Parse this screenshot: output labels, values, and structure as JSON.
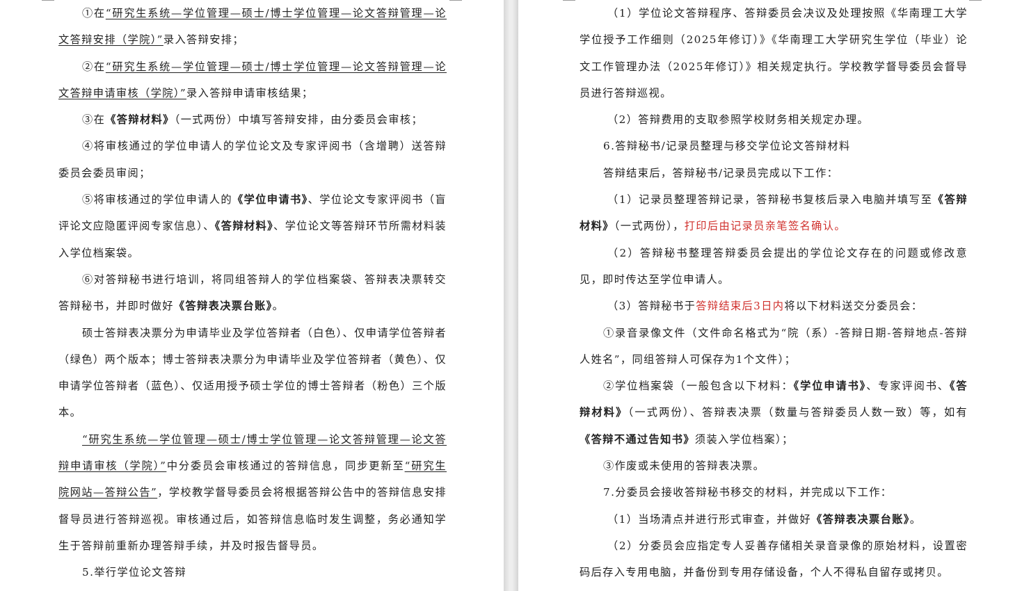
{
  "left_page": {
    "paragraphs": [
      {
        "segments": [
          {
            "t": "①在",
            "s": ""
          },
          {
            "t": "“研究生系统—学位管理—硕士/博士学位管理—论文答辩管理—论文答辩安排（学院）”",
            "s": "u"
          },
          {
            "t": "录入答辩安排；",
            "s": ""
          }
        ]
      },
      {
        "segments": [
          {
            "t": "②在",
            "s": ""
          },
          {
            "t": "“研究生系统—学位管理—硕士/博士学位管理—论文答辩管理—论文答辩申请审核（学院）”",
            "s": "u"
          },
          {
            "t": "录入答辩申请审核结果；",
            "s": ""
          }
        ]
      },
      {
        "segments": [
          {
            "t": "③在",
            "s": ""
          },
          {
            "t": "《答辩材料》",
            "s": "b"
          },
          {
            "t": "（一式两份）中填写答辩安排，由分委员会审核；",
            "s": ""
          }
        ]
      },
      {
        "segments": [
          {
            "t": "④将审核通过的学位申请人的学位论文及专家评阅书（含增聘）送答辩委员会委员审阅；",
            "s": ""
          }
        ]
      },
      {
        "segments": [
          {
            "t": "⑤将审核通过的学位申请人的",
            "s": ""
          },
          {
            "t": "《学位申请书》",
            "s": "b"
          },
          {
            "t": "、学位论文专家评阅书（盲评论文应隐匿评阅专家信息）、",
            "s": ""
          },
          {
            "t": "《答辩材料》",
            "s": "b"
          },
          {
            "t": "、学位论文等答辩环节所需材料装入学位档案袋。",
            "s": ""
          }
        ]
      },
      {
        "segments": [
          {
            "t": "⑥对答辩秘书进行培训，将同组答辩人的学位档案袋、答辩表决票转交答辩秘书，并即时做好",
            "s": ""
          },
          {
            "t": "《答辩表决票台账》",
            "s": "b"
          },
          {
            "t": "。",
            "s": ""
          }
        ]
      },
      {
        "segments": [
          {
            "t": "硕士答辩表决票分为申请毕业及学位答辩者（白色）、仅申请学位答辩者（绿色）两个版本；博士答辩表决票分为申请毕业及学位答辩者（黄色）、仅申请学位答辩者（蓝色）、仅适用授予硕士学位的博士答辩者（粉色）三个版本。",
            "s": ""
          }
        ]
      },
      {
        "segments": [
          {
            "t": "“研究生系统—学位管理—硕士/博士学位管理—论文答辩管理—论文答辩申请审核（学院）”",
            "s": "u"
          },
          {
            "t": "中分委员会审核通过的答辩信息，同步更新至",
            "s": ""
          },
          {
            "t": "“研究生院网站—答辩公告”",
            "s": "u"
          },
          {
            "t": "，学校教学督导委员会将根据答辩公告中的答辩信息安排督导员进行答辩巡视。审核通过后，如答辩信息临时发生调整，务必通知学生于答辩前重新办理答辩手续，并及时报告督导员。",
            "s": ""
          }
        ]
      },
      {
        "segments": [
          {
            "t": "5.举行学位论文答辩",
            "s": ""
          }
        ]
      }
    ]
  },
  "right_page": {
    "paragraphs": [
      {
        "segments": [
          {
            "t": "（1）学位论文答辩程序、答辩委员会决议及处理按照《华南理工大学学位授予工作细则（2025年修订）》《华南理工大学研究生学位（毕业）论文工作管理办法（2025年修订）》相关规定执行。学校教学督导委员会督导员进行答辩巡视。",
            "s": ""
          }
        ]
      },
      {
        "segments": [
          {
            "t": "（2）答辩费用的支取参照学校财务相关规定办理。",
            "s": ""
          }
        ]
      },
      {
        "segments": [
          {
            "t": "6.答辩秘书/记录员整理与移交学位论文答辩材料",
            "s": ""
          }
        ]
      },
      {
        "segments": [
          {
            "t": "答辩结束后，答辩秘书/记录员完成以下工作：",
            "s": ""
          }
        ]
      },
      {
        "segments": [
          {
            "t": "（1）记录员整理答辩记录，答辩秘书复核后录入电脑并填写至",
            "s": ""
          },
          {
            "t": "《答辩材料》",
            "s": "b"
          },
          {
            "t": "（一式两份），",
            "s": ""
          },
          {
            "t": "打印后由记录员亲笔签名确认。",
            "s": "red"
          }
        ]
      },
      {
        "segments": [
          {
            "t": "（2）答辩秘书整理答辩委员会提出的学位论文存在的问题或修改意见，即时传达至学位申请人。",
            "s": ""
          }
        ]
      },
      {
        "segments": [
          {
            "t": "（3）答辩秘书于",
            "s": ""
          },
          {
            "t": "答辩结束后3日内",
            "s": "red"
          },
          {
            "t": "将以下材料送交分委员会：",
            "s": ""
          }
        ]
      },
      {
        "segments": [
          {
            "t": "①录音录像文件（文件命名格式为“院（系）-答辩日期-答辩地点-答辩人姓名”，同组答辩人可保存为1个文件）；",
            "s": ""
          }
        ]
      },
      {
        "segments": [
          {
            "t": "②学位档案袋（一般包含以下材料：",
            "s": ""
          },
          {
            "t": "《学位申请书》",
            "s": "b"
          },
          {
            "t": "、专家评阅书、",
            "s": ""
          },
          {
            "t": "《答辩材料》",
            "s": "b"
          },
          {
            "t": "（一式两份）、答辩表决票（数量与答辩委员人数一致）等，如有",
            "s": ""
          },
          {
            "t": "《答辩不通过告知书》",
            "s": "b"
          },
          {
            "t": "须装入学位档案）；",
            "s": ""
          }
        ]
      },
      {
        "segments": [
          {
            "t": "③作废或未使用的答辩表决票。",
            "s": ""
          }
        ]
      },
      {
        "segments": [
          {
            "t": "7.分委员会接收答辩秘书移交的材料，并完成以下工作：",
            "s": ""
          }
        ]
      },
      {
        "segments": [
          {
            "t": "（1）当场清点并进行形式审查，并做好",
            "s": ""
          },
          {
            "t": "《答辩表决票台账》",
            "s": "b"
          },
          {
            "t": "。",
            "s": ""
          }
        ]
      },
      {
        "segments": [
          {
            "t": "（2）分委员会应指定专人妥善存储相关录音录像的原始材料，设置密码后存入专用电脑，并备份到专用存储设备，个人不得私自留存或拷贝。",
            "s": ""
          }
        ]
      }
    ]
  }
}
